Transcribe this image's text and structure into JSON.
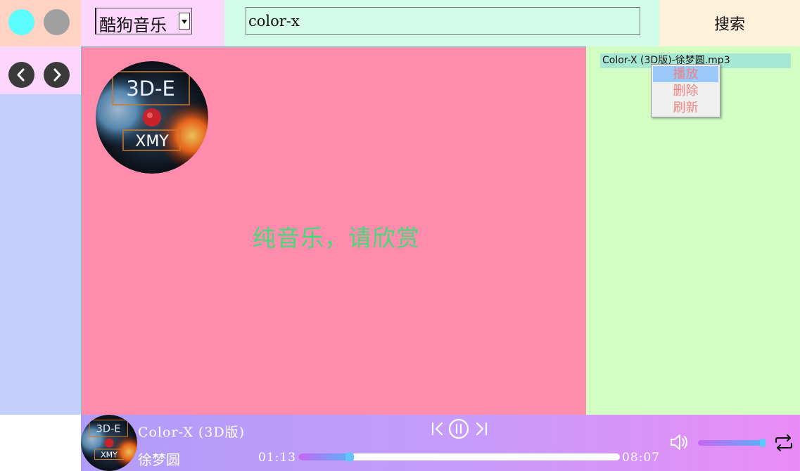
{
  "source_select": {
    "value": "酷狗音乐"
  },
  "search": {
    "value": "color-x",
    "button_label": "搜索"
  },
  "disc": {
    "top_text": "3D-E",
    "bottom_text": "XMY"
  },
  "main": {
    "lyric_text": "纯音乐，请欣赏"
  },
  "playlist": {
    "items": [
      {
        "label": "Color-X (3D版)-徐梦圆.mp3"
      }
    ]
  },
  "context_menu": {
    "items": [
      "播放",
      "删除",
      "刷新"
    ]
  },
  "player": {
    "title": "Color-X (3D版)",
    "artist": "徐梦圆",
    "current_time": "01:13",
    "total_time": "08:07",
    "progress": 0.16,
    "volume": 0.98
  },
  "icons": {
    "window_dot_1": "close-dot-icon",
    "window_dot_2": "minimize-dot-icon",
    "back": "chevron-left-icon",
    "forward": "chevron-right-icon",
    "prev": "skip-previous-icon",
    "pause": "pause-icon",
    "next": "skip-next-icon",
    "volume": "volume-icon",
    "loop": "repeat-icon"
  },
  "colors": {
    "accent_pink": "#ff8bad",
    "lyric_green": "#44d97a",
    "playlist_green": "#d2fec3",
    "menu_text": "#f08282"
  }
}
